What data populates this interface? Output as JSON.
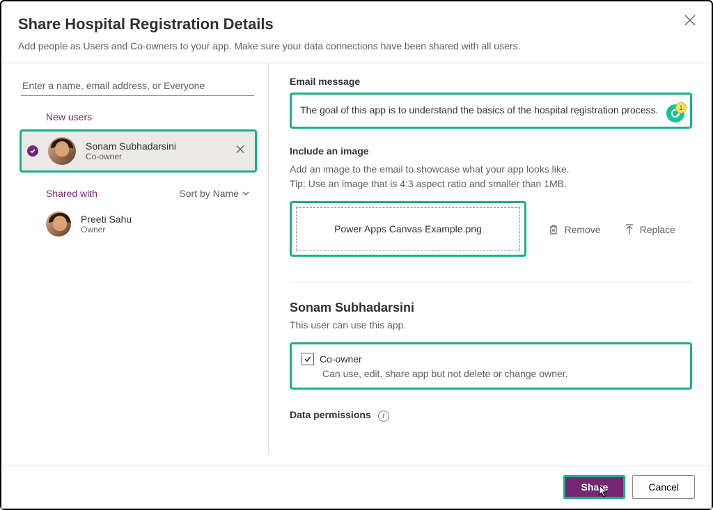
{
  "header": {
    "title": "Share Hospital Registration Details",
    "subtitle": "Add people as Users and Co-owners to your app. Make sure your data connections have been shared with all users."
  },
  "left": {
    "search_placeholder": "Enter a name, email address, or Everyone",
    "new_users_label": "New users",
    "selected_user": {
      "name": "Sonam Subhadarsini",
      "role": "Co-owner"
    },
    "shared_with_label": "Shared with",
    "sort_label": "Sort by Name",
    "owner_user": {
      "name": "Preeti Sahu",
      "role": "Owner"
    }
  },
  "right": {
    "email_label": "Email message",
    "email_body": "The goal of this app is to understand the basics of the hospital registration process.",
    "grammarly_count": "1",
    "image_label": "Include an image",
    "image_hint1": "Add an image to the email to showcase what your app looks like.",
    "image_hint2": "Tip: Use an image that is 4:3 aspect ratio and smaller than 1MB.",
    "image_filename": "Power Apps Canvas Example.png",
    "remove_label": "Remove",
    "replace_label": "Replace",
    "selected_name": "Sonam Subhadarsini",
    "selected_desc": "This user can use this app.",
    "coowner_label": "Co-owner",
    "coowner_desc": "Can use, edit, share app but not delete or change owner.",
    "data_perm_label": "Data permissions"
  },
  "footer": {
    "share": "Share",
    "cancel": "Cancel"
  }
}
